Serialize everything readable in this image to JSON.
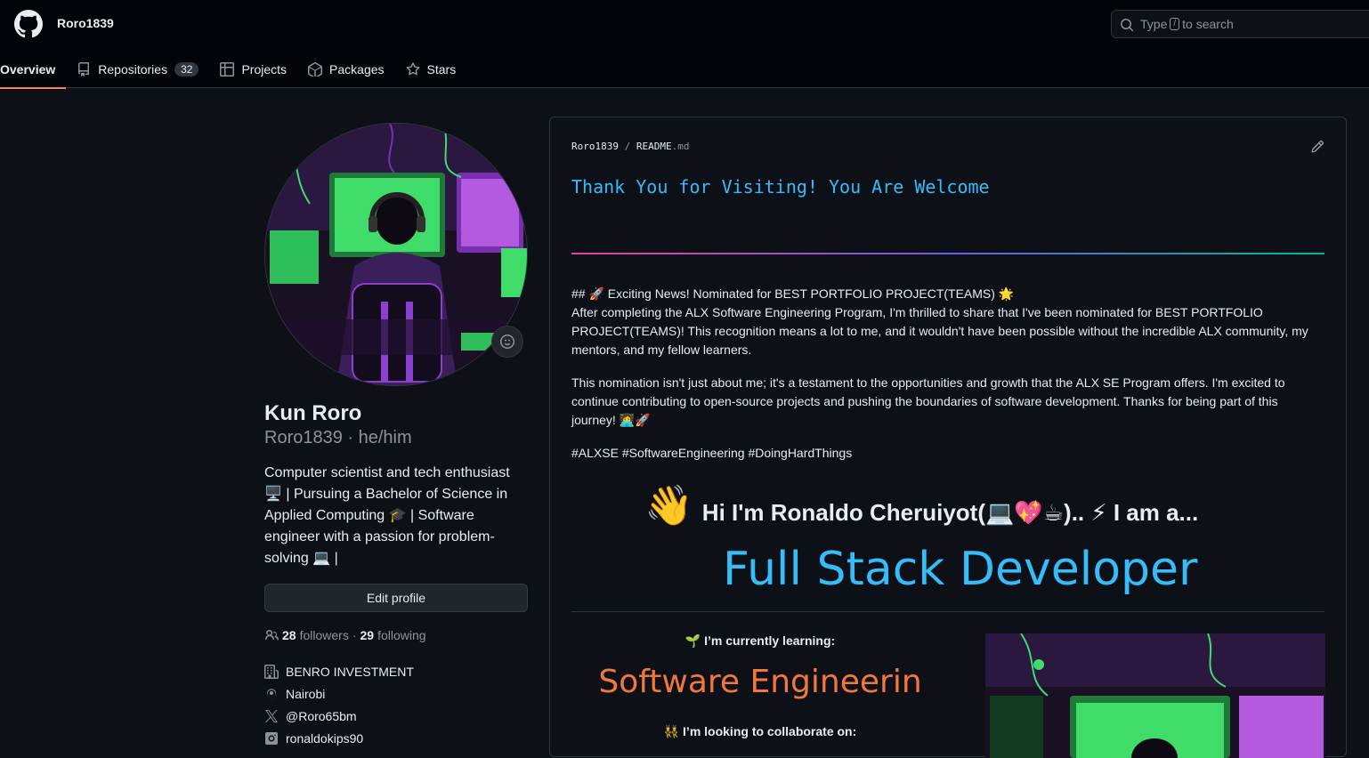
{
  "header": {
    "username": "Roro1839",
    "search_prefix": "Type",
    "search_key": "/",
    "search_suffix": "to search"
  },
  "nav": {
    "overview": "Overview",
    "repositories": "Repositories",
    "repositories_count": "32",
    "projects": "Projects",
    "packages": "Packages",
    "stars": "Stars"
  },
  "profile": {
    "fullname": "Kun Roro",
    "login": "Roro1839",
    "pronouns": "he/him",
    "bio": "Computer scientist and tech enthusiast 🖥️ | Pursuing a Bachelor of Science in Applied Computing 🎓 | Software engineer with a passion for problem-solving 💻 |",
    "edit_button": "Edit profile",
    "followers_count": "28",
    "followers_label": "followers",
    "following_count": "29",
    "following_label": "following",
    "company": "BENRO INVESTMENT",
    "location": "Nairobi",
    "twitter": "@Roro65bm",
    "instagram": "ronaldokips90"
  },
  "readme": {
    "owner": "Roro1839",
    "file": "README",
    "ext": ".md",
    "typing_text": "Thank You for Visiting! You Are Welcome",
    "p1_line1": "## 🚀 Exciting News! Nominated for BEST PORTFOLIO PROJECT(TEAMS) 🌟",
    "p1_line2": "After completing the ALX Software Engineering Program, I'm thrilled to share that I've been nominated for BEST PORTFOLIO PROJECT(TEAMS)! This recognition means a lot to me, and it wouldn't have been possible without the incredible ALX community, my mentors, and my fellow learners.",
    "p2": "This nomination isn't just about me; it's a testament to the opportunities and growth that the ALX SE Program offers. I'm excited to continue contributing to open-source projects and pushing the boundaries of software development. Thanks for being part of this journey! 👩‍💻🚀",
    "p3": "#ALXSE #SoftwareEngineering #DoingHardThings",
    "wave": "👋",
    "hi_text": "Hi I'm Ronaldo Cheruiyot(💻💖☕).. ⚡ I am a...",
    "role": "Full Stack Developer",
    "learning_label": "🌱 I’m currently learning:",
    "learning_value": "Software Engineerin",
    "collab_label": "👯 I’m looking to collaborate on:"
  },
  "colors": {
    "accent": "#f78166",
    "typing": "#36bcf7",
    "learning": "#f3773b"
  }
}
